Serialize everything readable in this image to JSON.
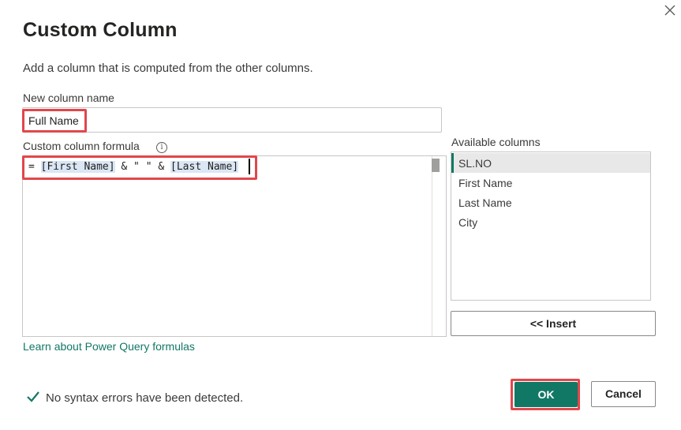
{
  "dialog": {
    "title": "Custom Column",
    "subtitle": "Add a column that is computed from the other columns."
  },
  "new_column": {
    "label": "New column name",
    "value": "Full Name"
  },
  "formula": {
    "label": "Custom column formula",
    "info_glyph": "i",
    "prefix": "= ",
    "ref1": "[First Name]",
    "middle": " & \" \" & ",
    "ref2": "[Last Name]"
  },
  "learn_link": "Learn about Power Query formulas",
  "available": {
    "label": "Available columns",
    "items": [
      "SL.NO",
      "First Name",
      "Last Name",
      "City"
    ],
    "selected_index": 0
  },
  "insert_label": "<< Insert",
  "status": {
    "text": "No syntax errors have been detected.",
    "icon": "check-icon"
  },
  "buttons": {
    "ok": "OK",
    "cancel": "Cancel"
  },
  "colors": {
    "accent": "#117865",
    "highlight": "#e0474c"
  }
}
